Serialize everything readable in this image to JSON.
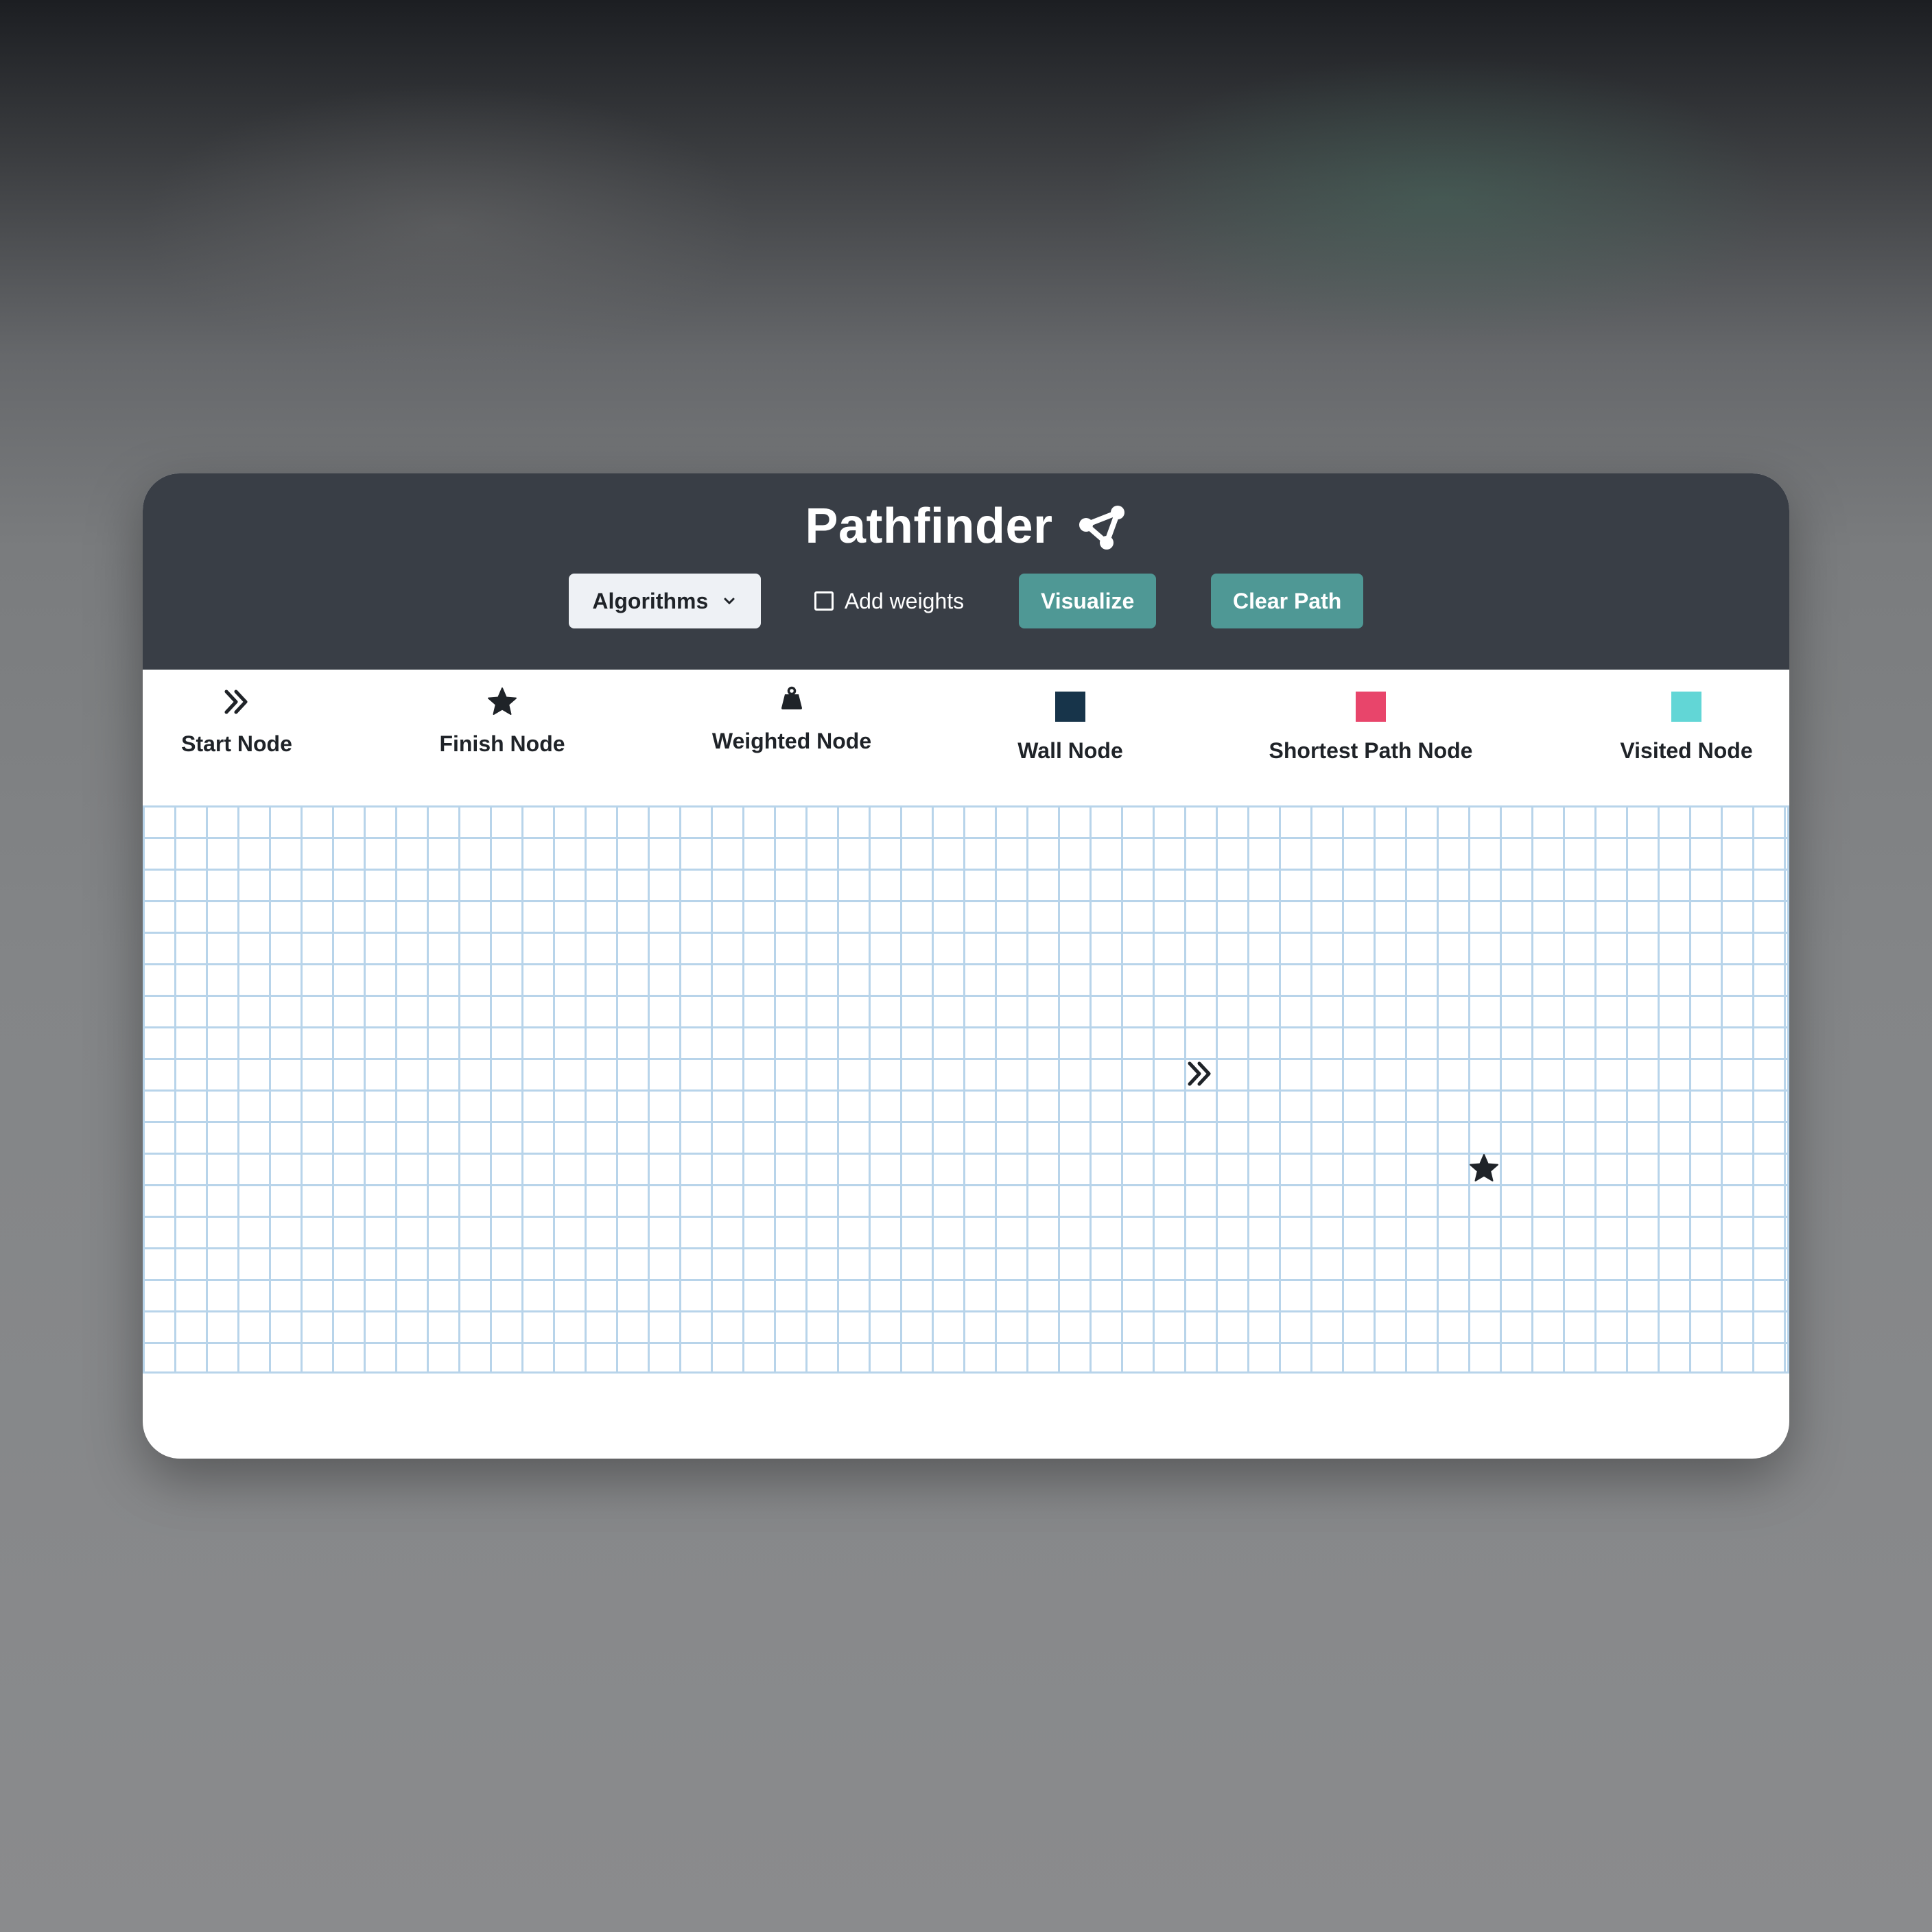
{
  "app": {
    "title": "Pathfinder",
    "logo_icon": "graph-nodes-icon"
  },
  "toolbar": {
    "algorithms_label": "Algorithms",
    "weights_label": "Add weights",
    "weights_checked": false,
    "visualize_label": "Visualize",
    "clear_label": "Clear Path"
  },
  "legend": {
    "start_label": "Start Node",
    "finish_label": "Finish Node",
    "weighted_label": "Weighted Node",
    "wall_label": "Wall Node",
    "shortest_label": "Shortest Path Node",
    "visited_label": "Visited Node",
    "start_icon": "double-chevron-right-icon",
    "finish_icon": "star-icon",
    "weighted_icon": "weight-icon"
  },
  "colors": {
    "header": "#393e46",
    "accent": "#4f9895",
    "wall": "#17344a",
    "shortest_path": "#e8456b",
    "visited": "#62d6d6",
    "grid_line": "#b8d4ea"
  },
  "grid": {
    "columns": 52,
    "rows": 18,
    "start_node": {
      "row": 8,
      "col": 33
    },
    "finish_node": {
      "row": 11,
      "col": 42
    }
  }
}
